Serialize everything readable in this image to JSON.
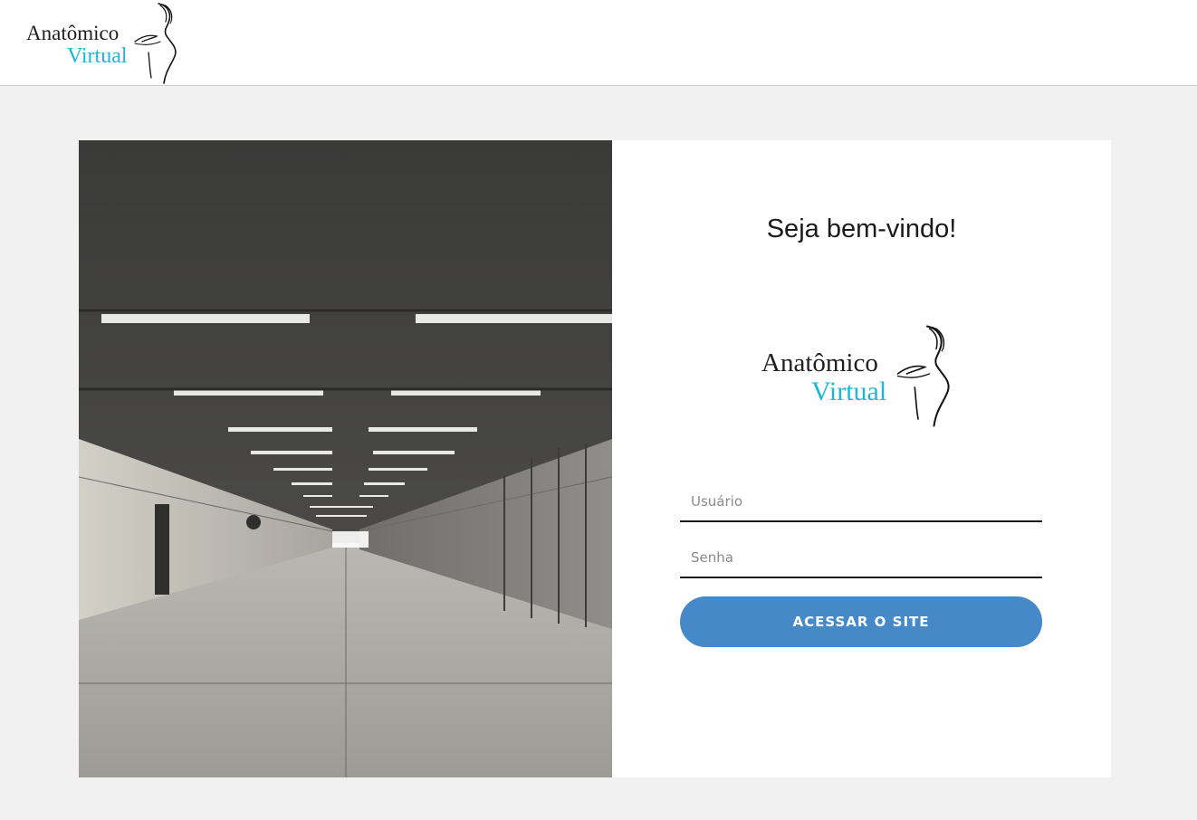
{
  "header": {
    "logo": {
      "line1": "Anatômico",
      "line2": "Virtual"
    }
  },
  "login": {
    "welcome": "Seja bem-vindo!",
    "logo": {
      "line1": "Anatômico",
      "line2": "Virtual"
    },
    "username_placeholder": "Usuário",
    "password_placeholder": "Senha",
    "submit_label": "ACESSAR O SITE"
  },
  "colors": {
    "brand_cyan": "#1ab7d8",
    "button_blue": "#4589c9",
    "background": "#f1f1f1"
  },
  "icons": {
    "logo_figure": "female-silhouette-icon"
  }
}
